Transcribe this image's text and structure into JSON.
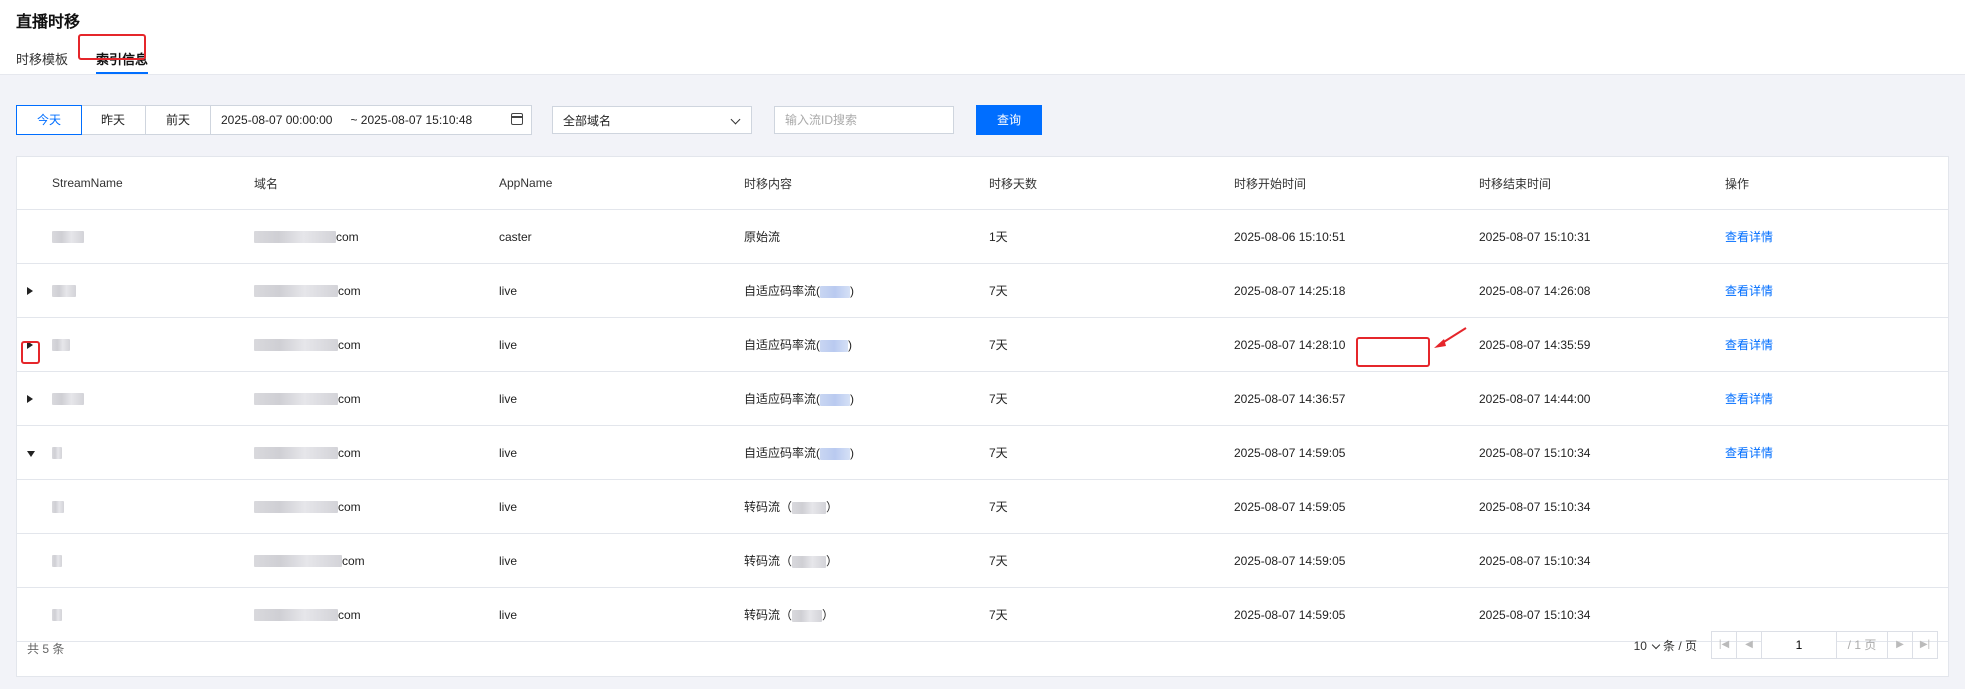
{
  "header": {
    "title": "直播时移",
    "tabs": [
      {
        "label": "时移模板",
        "active": false
      },
      {
        "label": "索引信息",
        "active": true
      }
    ]
  },
  "filter": {
    "date_buttons": [
      {
        "label": "今天",
        "active": true
      },
      {
        "label": "昨天",
        "active": false
      },
      {
        "label": "前天",
        "active": false
      }
    ],
    "start_time": "2025-08-07 00:00:00",
    "end_time": "~ 2025-08-07 15:10:48",
    "domain_select": "全部域名",
    "search_placeholder": "输入流ID搜索",
    "query_label": "查询"
  },
  "table": {
    "columns": [
      "StreamName",
      "域名",
      "AppName",
      "时移内容",
      "时移天数",
      "时移开始时间",
      "时移结束时间",
      "操作"
    ],
    "rows": [
      {
        "expand": "none",
        "domain_suffix": "com",
        "app": "caster",
        "content": "原始流",
        "content_suffix": "",
        "days": "1天",
        "start": "2025-08-06 15:10:51",
        "end": "2025-08-07 15:10:31",
        "action": "查看详情"
      },
      {
        "expand": "collapsed",
        "domain_suffix": "com",
        "app": "live",
        "content": "自适应码率流(",
        "content_suffix": ")",
        "days": "7天",
        "start": "2025-08-07 14:25:18",
        "end": "2025-08-07 14:26:08",
        "action": "查看详情"
      },
      {
        "expand": "collapsed",
        "domain_suffix": "com",
        "app": "live",
        "content": "自适应码率流(",
        "content_suffix": ")",
        "days": "7天",
        "start": "2025-08-07 14:28:10",
        "end": "2025-08-07 14:35:59",
        "action": "查看详情"
      },
      {
        "expand": "collapsed",
        "domain_suffix": "com",
        "app": "live",
        "content": "自适应码率流(",
        "content_suffix": ")",
        "days": "7天",
        "start": "2025-08-07 14:36:57",
        "end": "2025-08-07 14:44:00",
        "action": "查看详情"
      },
      {
        "expand": "expanded",
        "domain_suffix": "com",
        "app": "live",
        "content": "自适应码率流(",
        "content_suffix": ")",
        "days": "7天",
        "start": "2025-08-07 14:59:05",
        "end": "2025-08-07 15:10:34",
        "action": "查看详情"
      },
      {
        "expand": "child",
        "domain_suffix": "com",
        "app": "live",
        "content": "转码流（",
        "content_suffix": "）",
        "days": "7天",
        "start": "2025-08-07 14:59:05",
        "end": "2025-08-07 15:10:34",
        "action": ""
      },
      {
        "expand": "child",
        "domain_suffix": "com",
        "app": "live",
        "content": "转码流（",
        "content_suffix": "）",
        "days": "7天",
        "start": "2025-08-07 14:59:05",
        "end": "2025-08-07 15:10:34",
        "action": ""
      },
      {
        "expand": "child",
        "domain_suffix": "com",
        "app": "live",
        "content": "转码流（",
        "content_suffix": "）",
        "days": "7天",
        "start": "2025-08-07 14:59:05",
        "end": "2025-08-07 15:10:34",
        "action": ""
      }
    ]
  },
  "footer": {
    "total": "共 5 条",
    "page_size": "10",
    "page_size_unit": "条 / 页",
    "current_page": "1",
    "total_pages": "/ 1 页"
  },
  "colors": {
    "accent": "#006eff",
    "highlight": "#e5262b"
  }
}
